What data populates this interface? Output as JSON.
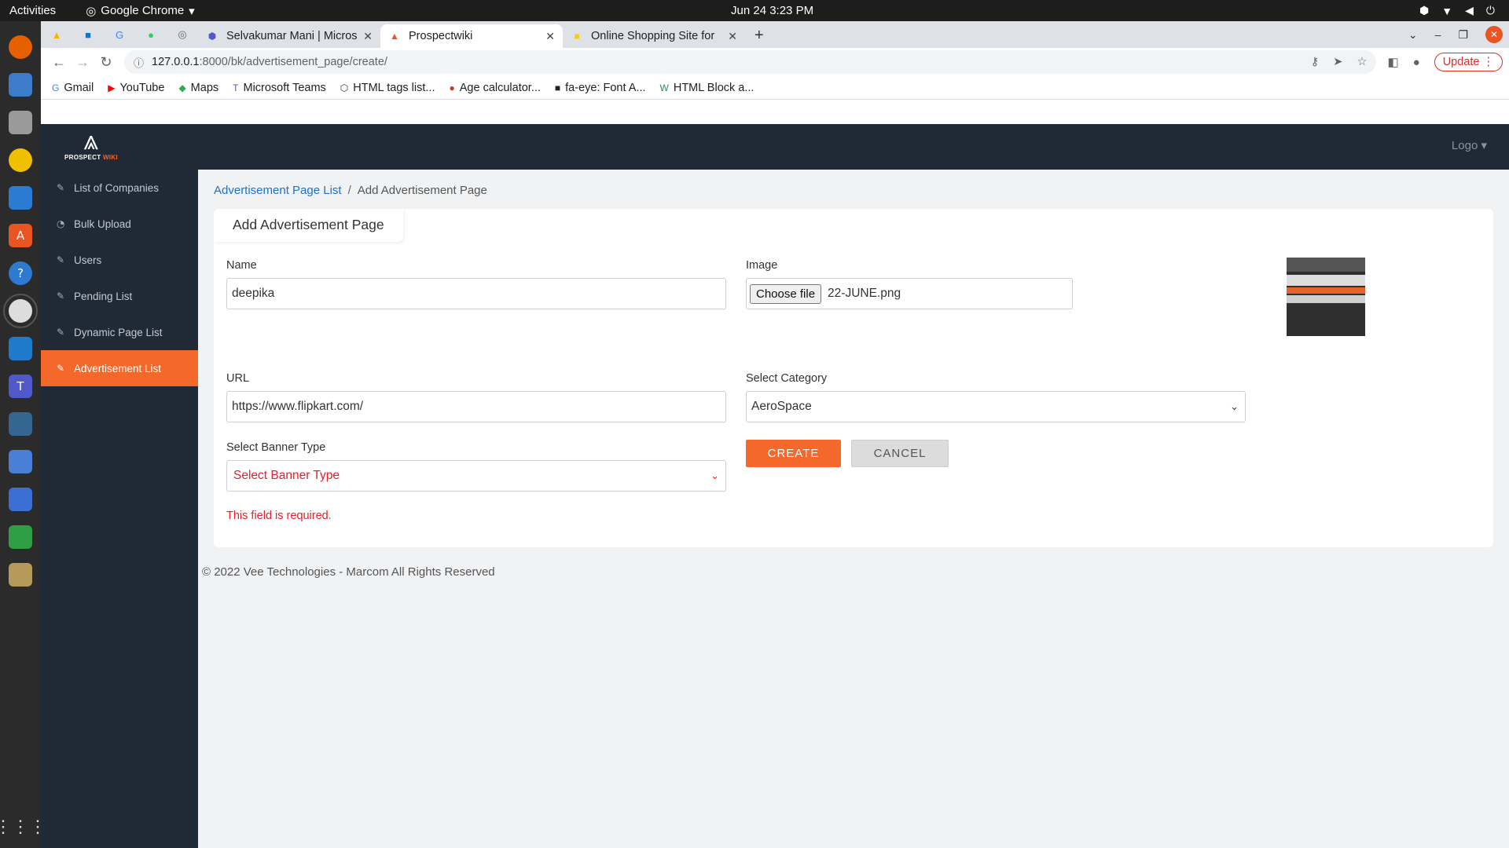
{
  "system": {
    "activities": "Activities",
    "app_name": "Google Chrome",
    "clock": "Jun 24  3:23 PM"
  },
  "chrome": {
    "tabs": [
      {
        "title": "Selvakumar Mani | Micros"
      },
      {
        "title": "Prospectwiki"
      },
      {
        "title": "Online Shopping Site for"
      }
    ],
    "url": {
      "host": "127.0.0.1",
      "path": ":8000/bk/advertisement_page/create/"
    },
    "update_label": "Update",
    "bookmarks": [
      {
        "label": "Gmail",
        "icon": "G"
      },
      {
        "label": "YouTube",
        "icon": "▶"
      },
      {
        "label": "Maps",
        "icon": "◆"
      },
      {
        "label": "Microsoft Teams",
        "icon": "T"
      },
      {
        "label": "HTML tags list...",
        "icon": "⬡"
      },
      {
        "label": "Age calculator...",
        "icon": "●"
      },
      {
        "label": "fa-eye: Font A...",
        "icon": "■"
      },
      {
        "label": "HTML Block a...",
        "icon": "W"
      }
    ]
  },
  "app": {
    "brand": {
      "line1": "PROSPECT",
      "line2": "WIKI"
    },
    "header_logo_alt": "Logo",
    "sidebar": [
      {
        "label": "List of Companies",
        "active": false
      },
      {
        "label": "Bulk Upload",
        "active": false
      },
      {
        "label": "Users",
        "active": false
      },
      {
        "label": "Pending List",
        "active": false
      },
      {
        "label": "Dynamic Page List",
        "active": false
      },
      {
        "label": "Advertisement List",
        "active": true
      }
    ],
    "breadcrumb": {
      "parent": "Advertisement Page List",
      "separator": "/",
      "current": "Add Advertisement Page"
    },
    "form": {
      "title": "Add Advertisement Page",
      "name_label": "Name",
      "name_value": "deepika",
      "image_label": "Image",
      "choose_file_label": "Choose file",
      "file_name": "22-JUNE.png",
      "url_label": "URL",
      "url_value": "https://www.flipkart.com/",
      "category_label": "Select Category",
      "category_value": "AeroSpace",
      "banner_label": "Select Banner Type",
      "banner_value": "Select Banner Type",
      "create_label": "CREATE",
      "cancel_label": "CANCEL",
      "error_text": "This field is required."
    },
    "footer": "© 2022 Vee Technologies - Marcom All Rights Reserved"
  },
  "colors": {
    "accent": "#f4682c",
    "sidebar_bg": "#1f2a36",
    "error": "#e4202b",
    "link": "#1a73c8"
  }
}
